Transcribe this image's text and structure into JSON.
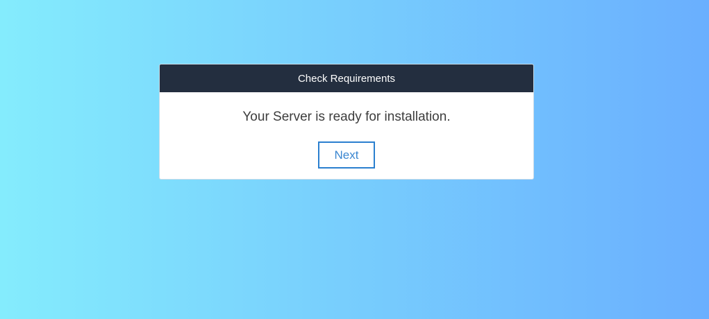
{
  "card": {
    "title": "Check Requirements",
    "message": "Your Server is ready for installation.",
    "next_label": "Next"
  },
  "colors": {
    "header_bg": "#232e3f",
    "accent": "#2a7fcf"
  }
}
